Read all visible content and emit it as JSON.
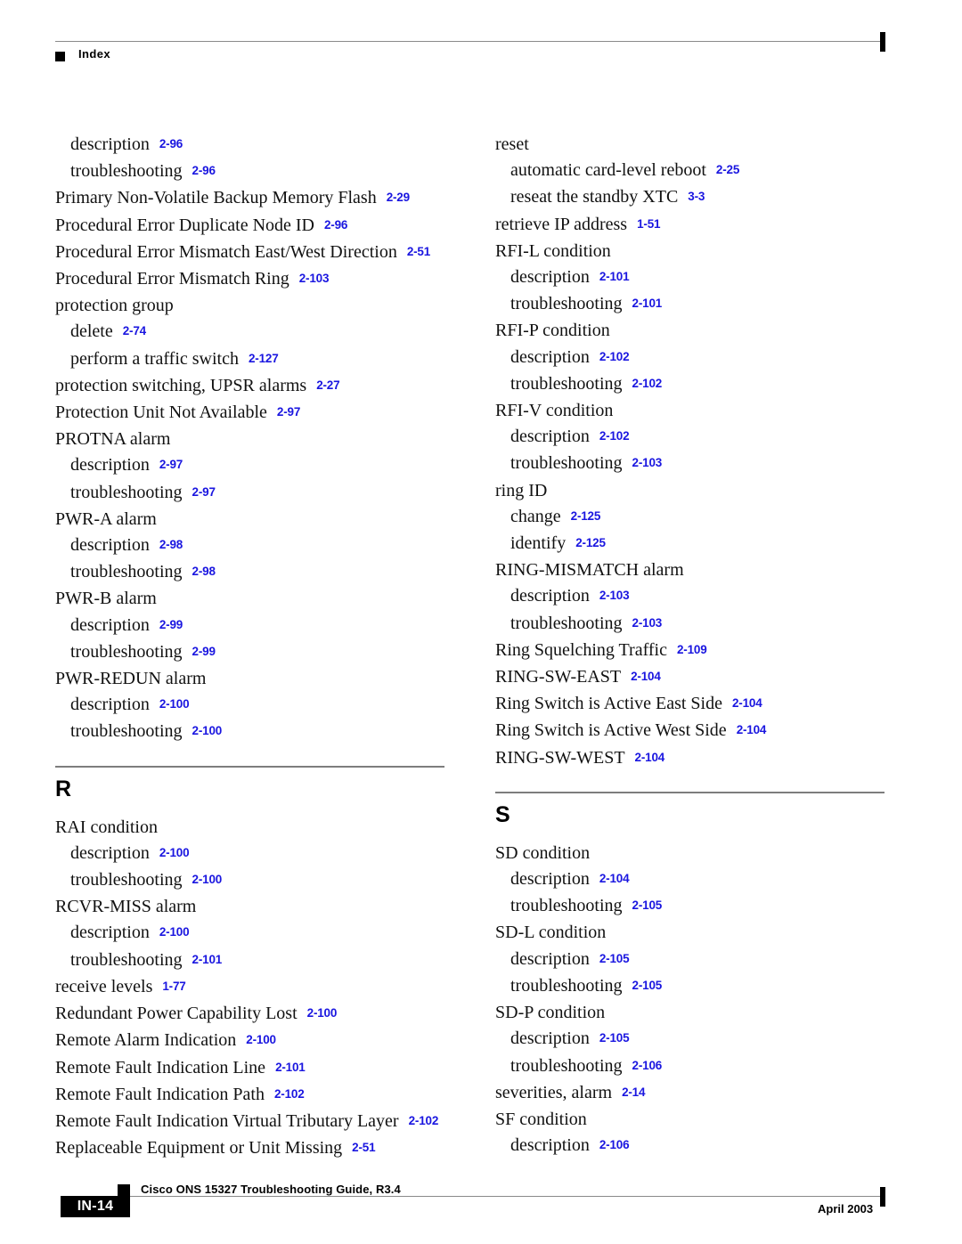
{
  "header": {
    "label": "Index"
  },
  "columns": {
    "left": [
      {
        "kind": "entry",
        "level": 2,
        "term": "description",
        "ref": "2-96"
      },
      {
        "kind": "entry",
        "level": 2,
        "term": "troubleshooting",
        "ref": "2-96"
      },
      {
        "kind": "entry",
        "level": 1,
        "term": "Primary Non-Volatile Backup Memory Flash",
        "ref": "2-29"
      },
      {
        "kind": "entry",
        "level": 1,
        "term": "Procedural Error Duplicate Node ID",
        "ref": "2-96"
      },
      {
        "kind": "entry",
        "level": 1,
        "term": "Procedural Error Mismatch East/West Direction",
        "ref": "2-51"
      },
      {
        "kind": "entry",
        "level": 1,
        "term": "Procedural Error Mismatch Ring",
        "ref": "2-103"
      },
      {
        "kind": "entry",
        "level": 1,
        "term": "protection group",
        "ref": ""
      },
      {
        "kind": "entry",
        "level": 2,
        "term": "delete",
        "ref": "2-74"
      },
      {
        "kind": "entry",
        "level": 2,
        "term": "perform a traffic switch",
        "ref": "2-127"
      },
      {
        "kind": "entry",
        "level": 1,
        "term": "protection switching, UPSR alarms",
        "ref": "2-27"
      },
      {
        "kind": "entry",
        "level": 1,
        "term": "Protection Unit Not Available",
        "ref": "2-97"
      },
      {
        "kind": "entry",
        "level": 1,
        "term": "PROTNA alarm",
        "ref": ""
      },
      {
        "kind": "entry",
        "level": 2,
        "term": "description",
        "ref": "2-97"
      },
      {
        "kind": "entry",
        "level": 2,
        "term": "troubleshooting",
        "ref": "2-97"
      },
      {
        "kind": "entry",
        "level": 1,
        "term": "PWR-A alarm",
        "ref": ""
      },
      {
        "kind": "entry",
        "level": 2,
        "term": "description",
        "ref": "2-98"
      },
      {
        "kind": "entry",
        "level": 2,
        "term": "troubleshooting",
        "ref": "2-98"
      },
      {
        "kind": "entry",
        "level": 1,
        "term": "PWR-B alarm",
        "ref": ""
      },
      {
        "kind": "entry",
        "level": 2,
        "term": "description",
        "ref": "2-99"
      },
      {
        "kind": "entry",
        "level": 2,
        "term": "troubleshooting",
        "ref": "2-99"
      },
      {
        "kind": "entry",
        "level": 1,
        "term": "PWR-REDUN alarm",
        "ref": ""
      },
      {
        "kind": "entry",
        "level": 2,
        "term": "description",
        "ref": "2-100"
      },
      {
        "kind": "entry",
        "level": 2,
        "term": "troubleshooting",
        "ref": "2-100"
      },
      {
        "kind": "section",
        "letter": "R"
      },
      {
        "kind": "entry",
        "level": 1,
        "term": "RAI condition",
        "ref": ""
      },
      {
        "kind": "entry",
        "level": 2,
        "term": "description",
        "ref": "2-100"
      },
      {
        "kind": "entry",
        "level": 2,
        "term": "troubleshooting",
        "ref": "2-100"
      },
      {
        "kind": "entry",
        "level": 1,
        "term": "RCVR-MISS alarm",
        "ref": ""
      },
      {
        "kind": "entry",
        "level": 2,
        "term": "description",
        "ref": "2-100"
      },
      {
        "kind": "entry",
        "level": 2,
        "term": "troubleshooting",
        "ref": "2-101"
      },
      {
        "kind": "entry",
        "level": 1,
        "term": "receive levels",
        "ref": "1-77"
      },
      {
        "kind": "entry",
        "level": 1,
        "term": "Redundant Power Capability Lost",
        "ref": "2-100"
      },
      {
        "kind": "entry",
        "level": 1,
        "term": "Remote Alarm Indication",
        "ref": "2-100"
      },
      {
        "kind": "entry",
        "level": 1,
        "term": "Remote Fault Indication Line",
        "ref": "2-101"
      },
      {
        "kind": "entry",
        "level": 1,
        "term": "Remote Fault Indication Path",
        "ref": "2-102"
      },
      {
        "kind": "entry",
        "level": 1,
        "term": "Remote Fault Indication Virtual Tributary Layer",
        "ref": "2-102"
      },
      {
        "kind": "entry",
        "level": 1,
        "term": "Replaceable Equipment or Unit Missing",
        "ref": "2-51"
      }
    ],
    "right": [
      {
        "kind": "entry",
        "level": 1,
        "term": "reset",
        "ref": ""
      },
      {
        "kind": "entry",
        "level": 2,
        "term": "automatic card-level reboot",
        "ref": "2-25"
      },
      {
        "kind": "entry",
        "level": 2,
        "term": "reseat the standby XTC",
        "ref": "3-3"
      },
      {
        "kind": "entry",
        "level": 1,
        "term": "retrieve IP address",
        "ref": "1-51"
      },
      {
        "kind": "entry",
        "level": 1,
        "term": "RFI-L condition",
        "ref": ""
      },
      {
        "kind": "entry",
        "level": 2,
        "term": "description",
        "ref": "2-101"
      },
      {
        "kind": "entry",
        "level": 2,
        "term": "troubleshooting",
        "ref": "2-101"
      },
      {
        "kind": "entry",
        "level": 1,
        "term": "RFI-P condition",
        "ref": ""
      },
      {
        "kind": "entry",
        "level": 2,
        "term": "description",
        "ref": "2-102"
      },
      {
        "kind": "entry",
        "level": 2,
        "term": "troubleshooting",
        "ref": "2-102"
      },
      {
        "kind": "entry",
        "level": 1,
        "term": "RFI-V condition",
        "ref": ""
      },
      {
        "kind": "entry",
        "level": 2,
        "term": "description",
        "ref": "2-102"
      },
      {
        "kind": "entry",
        "level": 2,
        "term": "troubleshooting",
        "ref": "2-103"
      },
      {
        "kind": "entry",
        "level": 1,
        "term": "ring ID",
        "ref": ""
      },
      {
        "kind": "entry",
        "level": 2,
        "term": "change",
        "ref": "2-125"
      },
      {
        "kind": "entry",
        "level": 2,
        "term": "identify",
        "ref": "2-125"
      },
      {
        "kind": "entry",
        "level": 1,
        "term": "RING-MISMATCH alarm",
        "ref": ""
      },
      {
        "kind": "entry",
        "level": 2,
        "term": "description",
        "ref": "2-103"
      },
      {
        "kind": "entry",
        "level": 2,
        "term": "troubleshooting",
        "ref": "2-103"
      },
      {
        "kind": "entry",
        "level": 1,
        "term": "Ring Squelching Traffic",
        "ref": "2-109"
      },
      {
        "kind": "entry",
        "level": 1,
        "term": "RING-SW-EAST",
        "ref": "2-104"
      },
      {
        "kind": "entry",
        "level": 1,
        "term": "Ring Switch is Active East Side",
        "ref": "2-104"
      },
      {
        "kind": "entry",
        "level": 1,
        "term": "Ring Switch is Active West Side",
        "ref": "2-104"
      },
      {
        "kind": "entry",
        "level": 1,
        "term": "RING-SW-WEST",
        "ref": "2-104"
      },
      {
        "kind": "section",
        "letter": "S"
      },
      {
        "kind": "entry",
        "level": 1,
        "term": "SD condition",
        "ref": ""
      },
      {
        "kind": "entry",
        "level": 2,
        "term": "description",
        "ref": "2-104"
      },
      {
        "kind": "entry",
        "level": 2,
        "term": "troubleshooting",
        "ref": "2-105"
      },
      {
        "kind": "entry",
        "level": 1,
        "term": "SD-L condition",
        "ref": ""
      },
      {
        "kind": "entry",
        "level": 2,
        "term": "description",
        "ref": "2-105"
      },
      {
        "kind": "entry",
        "level": 2,
        "term": "troubleshooting",
        "ref": "2-105"
      },
      {
        "kind": "entry",
        "level": 1,
        "term": "SD-P condition",
        "ref": ""
      },
      {
        "kind": "entry",
        "level": 2,
        "term": "description",
        "ref": "2-105"
      },
      {
        "kind": "entry",
        "level": 2,
        "term": "troubleshooting",
        "ref": "2-106"
      },
      {
        "kind": "entry",
        "level": 1,
        "term": "severities, alarm",
        "ref": "2-14"
      },
      {
        "kind": "entry",
        "level": 1,
        "term": "SF condition",
        "ref": ""
      },
      {
        "kind": "entry",
        "level": 2,
        "term": "description",
        "ref": "2-106"
      }
    ]
  },
  "footer": {
    "page_number": "IN-14",
    "guide_title": "Cisco ONS 15327 Troubleshooting Guide, R3.4",
    "date": "April 2003"
  },
  "colors": {
    "reference_link": "#1a16e0",
    "rule": "#8a8a8a",
    "text": "#111111"
  }
}
